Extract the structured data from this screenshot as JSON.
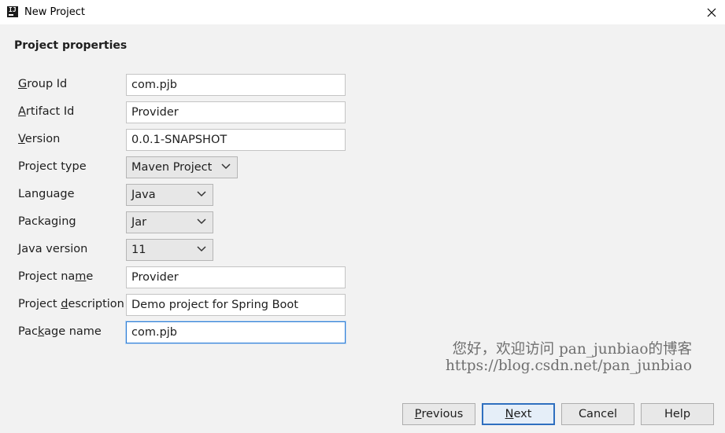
{
  "window": {
    "title": "New Project",
    "app_icon_text": "IJ"
  },
  "section_title": "Project properties",
  "fields": {
    "group_id": {
      "label": "Group Id",
      "mnemonic": "G",
      "rest": "roup Id",
      "value": "com.pjb"
    },
    "artifact_id": {
      "label": "Artifact Id",
      "mnemonic": "A",
      "rest": "rtifact Id",
      "value": "Provider"
    },
    "version": {
      "label": "Version",
      "mnemonic": "V",
      "rest": "ersion",
      "value": "0.0.1-SNAPSHOT"
    },
    "project_type": {
      "label": "Project type",
      "value": "Maven Project"
    },
    "language": {
      "label": "Language",
      "value": "Java"
    },
    "packaging": {
      "label": "Packaging",
      "value": "Jar"
    },
    "java_version": {
      "label": "Java version",
      "value": "11"
    },
    "project_name": {
      "label": "Project name",
      "pre": "Project na",
      "mnemonic": "m",
      "post": "e",
      "value": "Provider"
    },
    "project_description": {
      "label": "Project description",
      "pre": "Project ",
      "mnemonic": "d",
      "post": "escription",
      "value": "Demo project for Spring Boot"
    },
    "package_name": {
      "label": "Package name",
      "pre": "Pac",
      "mnemonic": "k",
      "post": "age name",
      "value": "com.pjb"
    }
  },
  "watermark": {
    "line1": "您好，欢迎访问 pan_junbiao的博客",
    "line2": "https://blog.csdn.net/pan_junbiao"
  },
  "buttons": {
    "previous": {
      "mnemonic": "P",
      "rest": "revious"
    },
    "next": {
      "mnemonic": "N",
      "rest": "ext"
    },
    "cancel": "Cancel",
    "help": "Help"
  },
  "colors": {
    "focus_border": "#2f7fd6",
    "primary_button_border": "#2f6fbf",
    "watermark": "#6f6f6f"
  }
}
